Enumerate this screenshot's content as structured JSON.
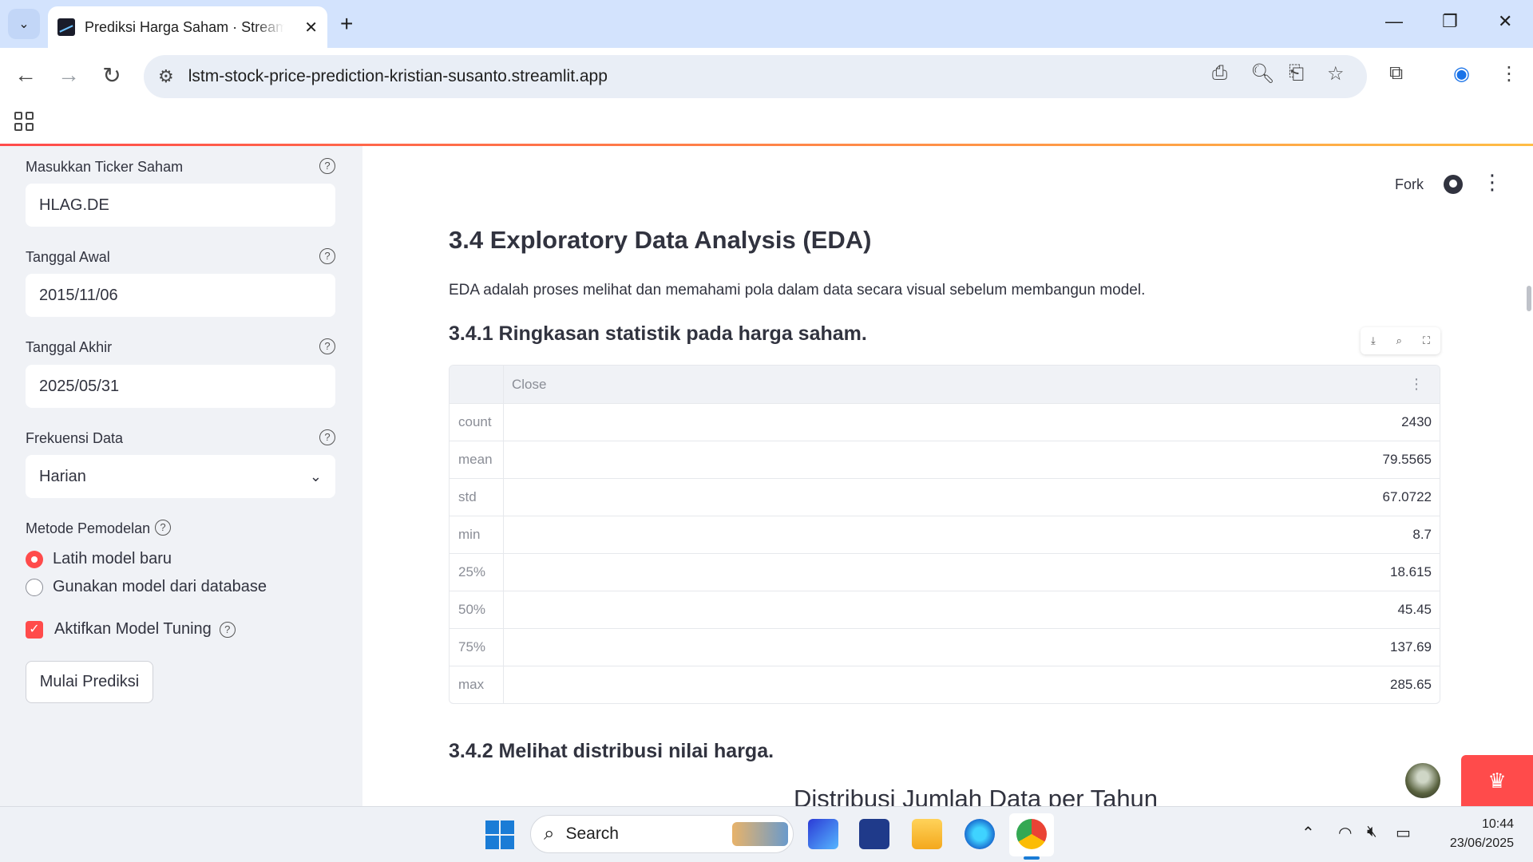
{
  "browser": {
    "tab_title": "Prediksi Harga Saham · Streamlit",
    "url": "lstm-stock-price-prediction-kristian-susanto.streamlit.app"
  },
  "sidebar": {
    "ticker": {
      "label": "Masukkan Ticker Saham",
      "value": "HLAG.DE"
    },
    "start_date": {
      "label": "Tanggal Awal",
      "value": "2015/11/06"
    },
    "end_date": {
      "label": "Tanggal Akhir",
      "value": "2025/05/31"
    },
    "frequency": {
      "label": "Frekuensi Data",
      "value": "Harian"
    },
    "method": {
      "label": "Metode Pemodelan",
      "options": [
        "Latih model baru",
        "Gunakan model dari database"
      ],
      "selected": "Latih model baru"
    },
    "tuning": {
      "label": "Aktifkan Model Tuning",
      "checked": true
    },
    "predict_button": "Mulai Prediksi"
  },
  "header": {
    "fork_label": "Fork"
  },
  "main": {
    "heading": "3.4 Exploratory Data Analysis (EDA)",
    "description": "EDA adalah proses melihat dan memahami pola dalam data secara visual sebelum membangun model.",
    "section1_title": "3.4.1 Ringkasan statistik pada harga saham.",
    "table": {
      "column": "Close",
      "rows": [
        {
          "stat": "count",
          "value": "2430"
        },
        {
          "stat": "mean",
          "value": "79.5565"
        },
        {
          "stat": "std",
          "value": "67.0722"
        },
        {
          "stat": "min",
          "value": "8.7"
        },
        {
          "stat": "25%",
          "value": "18.615"
        },
        {
          "stat": "50%",
          "value": "45.45"
        },
        {
          "stat": "75%",
          "value": "137.69"
        },
        {
          "stat": "max",
          "value": "285.65"
        }
      ]
    },
    "section2_title": "3.4.2 Melihat distribusi nilai harga.",
    "chart_title": "Distribusi Jumlah Data per Tahun"
  },
  "taskbar": {
    "search_placeholder": "Search",
    "time": "10:44",
    "date": "23/06/2025"
  },
  "colors": {
    "accent": "#ff4b4b",
    "sidebar_bg": "#f0f2f6",
    "browser_frame": "#d3e3fd"
  }
}
